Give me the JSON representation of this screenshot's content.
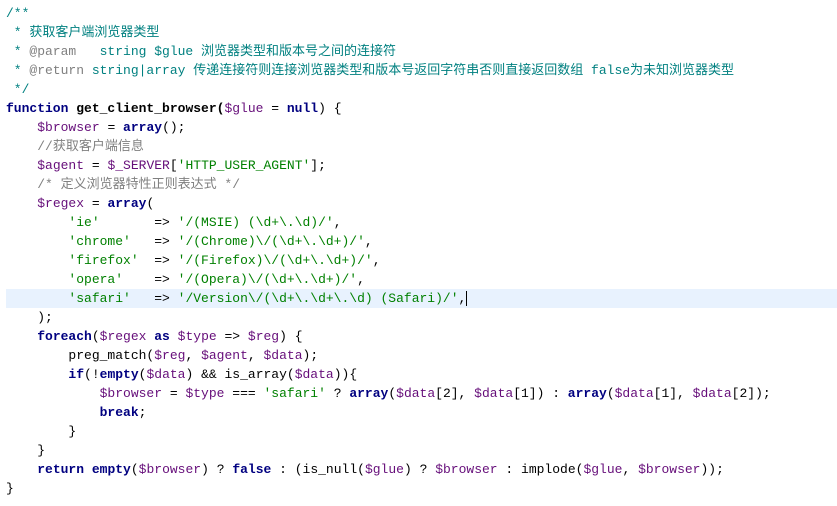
{
  "doc": {
    "open": "/**",
    "l1a": " * ",
    "l1b": "获取客户端浏览器类型",
    "l2a": " * ",
    "l2tag": "@param",
    "l2b": "   string $glue 浏览器类型和版本号之间的连接符",
    "l3a": " * ",
    "l3tag": "@return",
    "l3b": " string|array 传递连接符则连接浏览器类型和版本号返回字符串否则直接返回数组 false为未知浏览器类型",
    "close": " */"
  },
  "fn": {
    "kw": "function",
    "name": " get_client_browser(",
    "var_glue": "$glue",
    "eq": " = ",
    "null": "null",
    "tail": ") {"
  },
  "b1": {
    "pad": "    ",
    "var": "$browser",
    "mid": " = ",
    "kw": "array",
    "tail": "();"
  },
  "c1": {
    "pad": "    ",
    "t": "//获取客户端信息"
  },
  "b2": {
    "pad": "    ",
    "var": "$agent",
    "mid": " = ",
    "v2": "$_SERVER",
    "br1": "[",
    "str": "'HTTP_USER_AGENT'",
    "br2": "];"
  },
  "c2": {
    "pad": "    ",
    "t": "/* 定义浏览器特性正则表达式 */"
  },
  "rx": {
    "pad": "    ",
    "var": "$regex",
    "mid": " = ",
    "kw": "array",
    "tail": "("
  },
  "rows": {
    "ie": {
      "pad": "        ",
      "k": "'ie'",
      "sep": "       => ",
      "v": "'/(MSIE) (\\d+\\.\\d)/'",
      "end": ","
    },
    "chrome": {
      "pad": "        ",
      "k": "'chrome'",
      "sep": "   => ",
      "v": "'/(Chrome)\\/(\\d+\\.\\d+)/'",
      "end": ","
    },
    "firefox": {
      "pad": "        ",
      "k": "'firefox'",
      "sep": "  => ",
      "v": "'/(Firefox)\\/(\\d+\\.\\d+)/'",
      "end": ","
    },
    "opera": {
      "pad": "        ",
      "k": "'opera'",
      "sep": "    => ",
      "v": "'/(Opera)\\/(\\d+\\.\\d+)/'",
      "end": ","
    },
    "safari": {
      "pad": "        ",
      "k": "'safari'",
      "sep": "   => ",
      "v": "'/Version\\/(\\d+\\.\\d+\\.\\d) (Safari)/'",
      "end": ","
    }
  },
  "rxclose": {
    "pad": "    ",
    "t": ");"
  },
  "fe": {
    "pad": "    ",
    "kw": "foreach",
    "mid": "(",
    "v1": "$regex",
    "as": " as ",
    "v2": "$type",
    "arr": " => ",
    "v3": "$reg",
    "tail": ") {"
  },
  "pm": {
    "pad": "        ",
    "t1": "preg_match(",
    "v1": "$reg",
    "c1": ", ",
    "v2": "$agent",
    "c2": ", ",
    "v3": "$data",
    "t2": ");"
  },
  "ife": {
    "pad": "        ",
    "kw": "if",
    "t1": "(!",
    "kw2": "empty",
    "t2": "(",
    "v1": "$data",
    "t3": ") && is_array(",
    "v2": "$data",
    "t4": ")){"
  },
  "asn": {
    "pad": "            ",
    "v1": "$browser",
    "t1": " = ",
    "v2": "$type",
    "t2": " === ",
    "str": "'safari'",
    "t3": " ? ",
    "kw1": "array",
    "t4": "(",
    "v3": "$data",
    "t5": "[2], ",
    "v4": "$data",
    "t6": "[1]) : ",
    "kw2": "array",
    "t7": "(",
    "v5": "$data",
    "t8": "[1], ",
    "v6": "$data",
    "t9": "[2]);"
  },
  "brk": {
    "pad": "            ",
    "kw": "break",
    "t": ";"
  },
  "cb1": {
    "pad": "        ",
    "t": "}"
  },
  "cb2": {
    "pad": "    ",
    "t": "}"
  },
  "ret": {
    "pad": "    ",
    "kw1": "return",
    "t1": " ",
    "kw2": "empty",
    "t2": "(",
    "v1": "$browser",
    "t3": ") ? ",
    "kw3": "false",
    "t4": " : (is_null(",
    "v2": "$glue",
    "t5": ") ? ",
    "v3": "$browser",
    "t6": " : implode(",
    "v4": "$glue",
    "t7": ", ",
    "v5": "$browser",
    "t8": "));"
  },
  "end": {
    "t": "}"
  }
}
